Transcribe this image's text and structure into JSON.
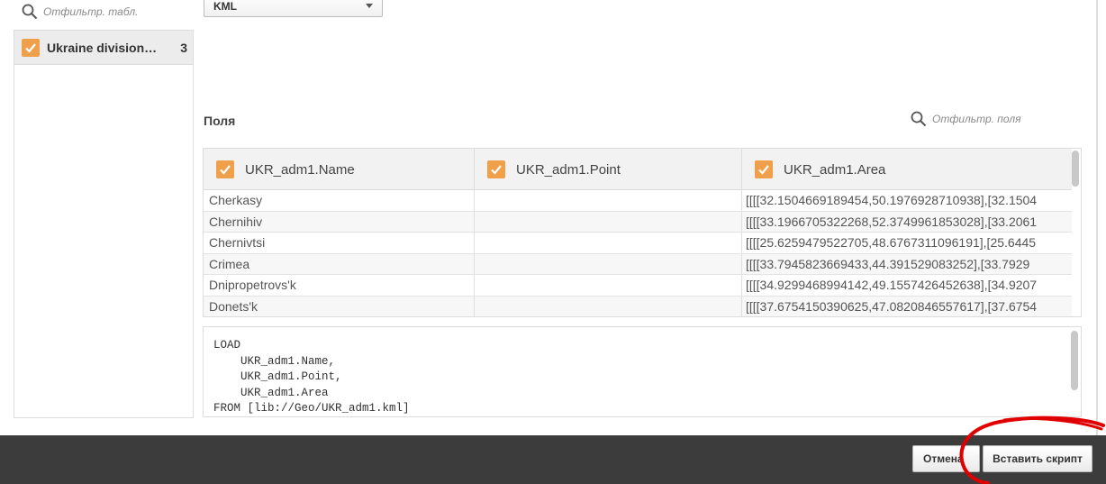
{
  "left_panel": {
    "filter_placeholder": "Отфильтр. табл.",
    "tables": [
      {
        "name": "Ukraine division…",
        "count": "3",
        "checked": true
      }
    ]
  },
  "format_select": {
    "value": "KML"
  },
  "fields": {
    "heading": "Поля",
    "filter_placeholder": "Отфильтр. поля",
    "columns": [
      {
        "label": "UKR_adm1.Name",
        "checked": true
      },
      {
        "label": "UKR_adm1.Point",
        "checked": true
      },
      {
        "label": "UKR_adm1.Area",
        "checked": true
      }
    ],
    "rows": [
      [
        "Cherkasy",
        "",
        "[[[[32.1504669189454,50.1976928710938],[32.1504"
      ],
      [
        "Chernihiv",
        "",
        "[[[[33.1966705322268,52.3749961853028],[33.2061"
      ],
      [
        "Chernivtsi",
        "",
        "[[[[25.6259479522705,48.6767311096191],[25.6445"
      ],
      [
        "Crimea",
        "",
        "[[[[33.7945823669433,44.391529083252],[33.7929"
      ],
      [
        "Dnipropetrovs'k",
        "",
        "[[[[34.9299468994142,49.1557426452638],[34.9207"
      ],
      [
        "Donets'k",
        "",
        "[[[[37.6754150390625,47.0820846557617],[37.6754"
      ]
    ]
  },
  "script": {
    "line1": "LOAD",
    "line2": "    UKR_adm1.Name,",
    "line3": "    UKR_adm1.Point,",
    "line4": "    UKR_adm1.Area",
    "line5": "FROM [lib://Geo/UKR_adm1.kml]"
  },
  "footer": {
    "cancel_label": "Отмена",
    "insert_label": "Вставить скрипт"
  },
  "colors": {
    "checkbox": "#f0a04b",
    "footer_bg": "#3c3c3c",
    "annotation": "#e00000"
  }
}
